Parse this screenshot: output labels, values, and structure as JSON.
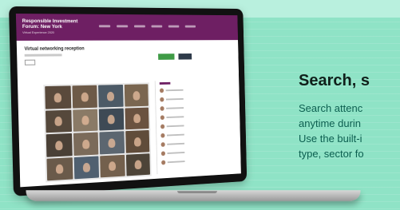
{
  "screen_app": {
    "logo_title": "Responsible Investment Forum: New York",
    "logo_subtitle": "Virtual Experience 2020",
    "page_title": "Virtual networking reception"
  },
  "hero": {
    "headline": "Search, s",
    "body_lines": [
      "Search attenc",
      "anytime durin",
      "Use the built-i",
      "type, sector fo"
    ]
  },
  "colors": {
    "background": "#8fe3c6",
    "app_header": "#6e1f63",
    "headline": "#10201b",
    "body_text": "#0c5f50",
    "join_button": "#3f9b46",
    "leave_button": "#2f3b4a"
  },
  "video_tiles": [
    "#5a4a3c",
    "#6d5a48",
    "#4c5a66",
    "#7a6650",
    "#55483b",
    "#8a7a66",
    "#3e4a55",
    "#6a5240",
    "#4a4036",
    "#7b6b5a",
    "#5c6670",
    "#604c3a",
    "#6a5a4a",
    "#506070",
    "#73604d",
    "#4d4438"
  ]
}
